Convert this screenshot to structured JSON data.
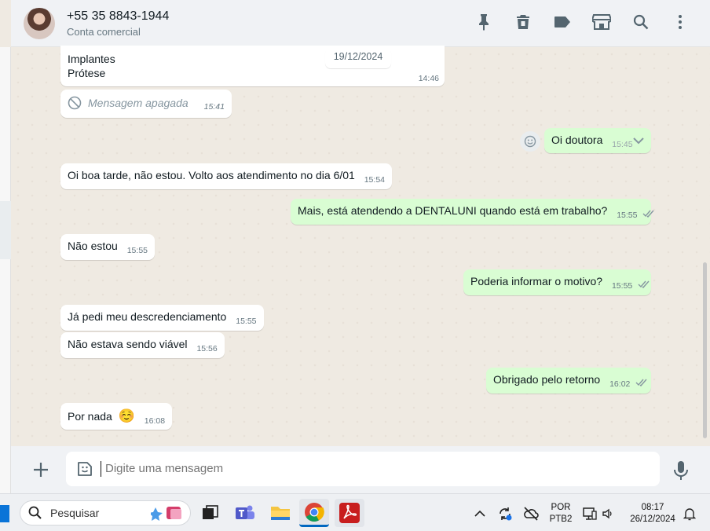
{
  "header": {
    "contact_name": "+55 35 8843-1944",
    "contact_subtitle": "Conta comercial",
    "icons": [
      "pin-icon",
      "delete-icon",
      "label-icon",
      "store-icon",
      "search-icon",
      "menu-dots-icon"
    ]
  },
  "chat": {
    "date_chip": "19/12/2024",
    "messages": [
      {
        "dir": "in",
        "lines": [
          "Implantes",
          "Prótese"
        ],
        "time": "14:46"
      },
      {
        "dir": "in",
        "deleted": true,
        "text": "Mensagem apagada",
        "time": "15:41"
      },
      {
        "dir": "out",
        "text": "Oi doutora",
        "time": "15:45"
      },
      {
        "dir": "in",
        "text": "Oi boa tarde, não estou. Volto aos atendimento no dia 6/01",
        "time": "15:54"
      },
      {
        "dir": "out",
        "text": "Mais, está atendendo a DENTALUNI quando está em trabalho?",
        "time": "15:55"
      },
      {
        "dir": "in",
        "text": "Não estou",
        "time": "15:55"
      },
      {
        "dir": "out",
        "text": "Poderia informar o motivo?",
        "time": "15:55"
      },
      {
        "dir": "in",
        "text": "Já pedi meu descredenciamento",
        "time": "15:55"
      },
      {
        "dir": "in",
        "text": "Não estava sendo viável",
        "time": "15:56"
      },
      {
        "dir": "out",
        "text": "Obrigado pelo retorno",
        "time": "16:02"
      },
      {
        "dir": "in",
        "text": "Por nada",
        "emoji": "☺️",
        "time": "16:08"
      }
    ]
  },
  "composer": {
    "placeholder": "Digite uma mensagem"
  },
  "taskbar": {
    "search_placeholder": "Pesquisar",
    "lang_top": "POR",
    "lang_bottom": "PTB2",
    "clock_time": "08:17",
    "clock_date": "26/12/2024"
  },
  "colors": {
    "incoming": "#ffffff",
    "outgoing": "#d9fdd3",
    "background": "#efeae2",
    "tick": "#8696a0"
  }
}
